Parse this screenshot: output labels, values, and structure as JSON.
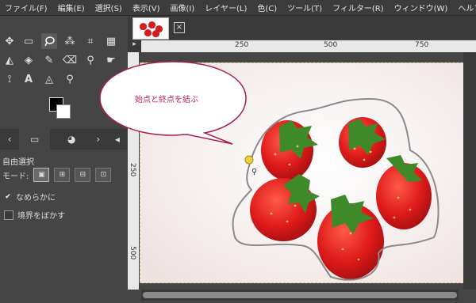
{
  "menu": {
    "items": [
      "ファイル(F)",
      "編集(E)",
      "選択(S)",
      "表示(V)",
      "画像(I)",
      "レイヤー(L)",
      "色(C)",
      "ツール(T)",
      "フィルター(R)",
      "ウィンドウ(W)",
      "ヘルプ(H)"
    ]
  },
  "ruler": {
    "h_labels": [
      "250",
      "500",
      "750"
    ],
    "v_labels": [
      "250",
      "500"
    ]
  },
  "tool_options": {
    "title": "自由選択",
    "mode_label": "モード:",
    "antialias_label": "なめらかに",
    "antialias_checked": true,
    "feather_label": "境界をぼかす",
    "feather_checked": false
  },
  "annotation": {
    "text": "始点と終点を結ぶ",
    "color": "#b8254a"
  },
  "colors": {
    "foreground": "#000000",
    "background": "#ffffff"
  },
  "icons": {
    "tools": [
      "move-icon",
      "rect-select-icon",
      "free-select-icon",
      "fuzzy-select-icon",
      "crop-icon",
      "unified-transform-icon",
      "warp-icon",
      "bucket-fill-icon",
      "paintbrush-icon",
      "eraser-icon",
      "clone-icon",
      "smudge-icon",
      "paths-icon",
      "text-icon",
      "color-picker-icon",
      "zoom-icon"
    ]
  }
}
